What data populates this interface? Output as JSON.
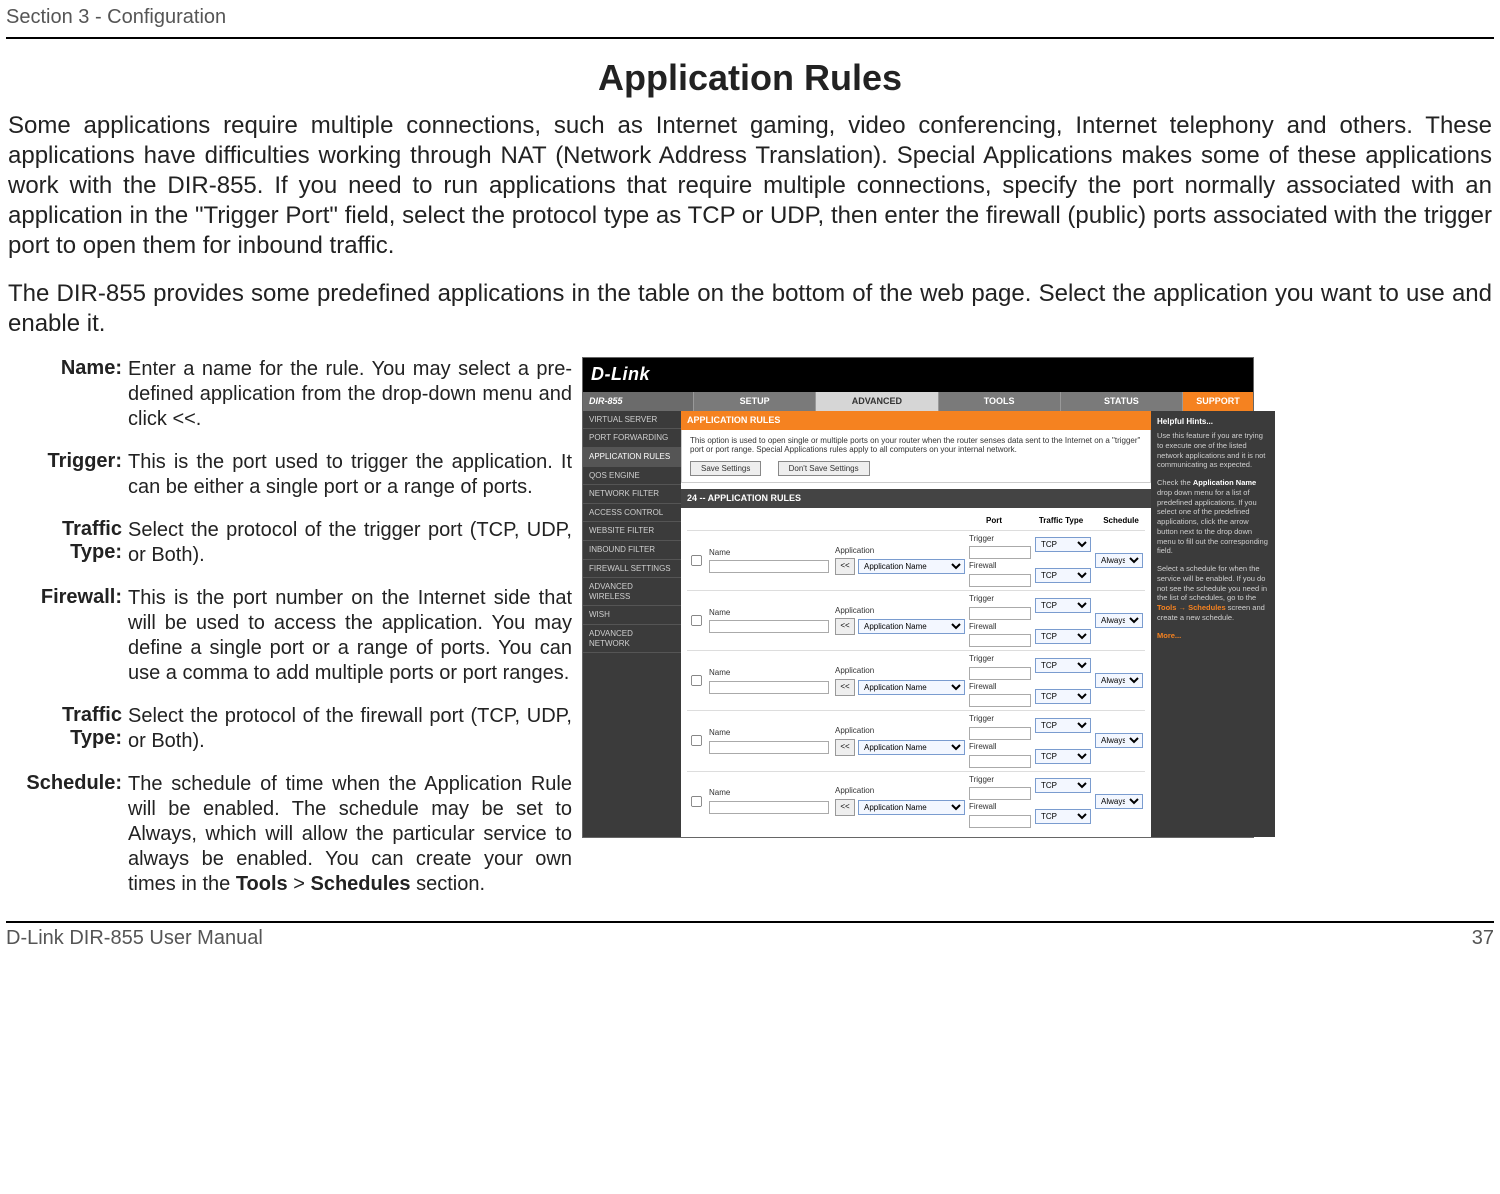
{
  "doc": {
    "section_header": "Section 3 - Configuration",
    "title": "Application Rules",
    "intro1": "Some applications require multiple connections, such as Internet gaming, video conferencing, Internet telephony and others. These applications have difficulties working through NAT (Network Address Translation). Special Applications makes some of these applications work with the DIR-855. If you need to run applications that require multiple connections, specify the port normally associated with an application in the \"Trigger Port\" field, select the protocol type as TCP or UDP, then enter the firewall (public) ports associated with the trigger port to open them for inbound traffic.",
    "intro2": "The DIR-855 provides some predefined applications in the table on the bottom of the web page. Select the application you want to use and enable it.",
    "footer_left": "D-Link DIR-855 User Manual",
    "footer_right": "37"
  },
  "defs": [
    {
      "term": "Name:",
      "desc": "Enter a name for the rule. You may select a pre-defined application from the drop-down menu and click <<."
    },
    {
      "term": "Trigger:",
      "desc": "This is the port used to trigger the application. It can be either a single port or a range of ports."
    },
    {
      "term": "Traffic Type:",
      "desc": "Select the protocol of the trigger port (TCP, UDP, or Both)."
    },
    {
      "term": "Firewall:",
      "desc": "This is the port number on the Internet side that will be used to access the application. You may define a single port or a range of ports. You can use a comma to add multiple ports or port ranges."
    },
    {
      "term": "Traffic Type:",
      "desc": "Select the protocol of the firewall port (TCP, UDP, or Both)."
    },
    {
      "term": "Schedule:",
      "desc_parts": [
        "The schedule of time when the Application Rule will be enabled. The schedule may be set to Always, which will allow the particular service to always be enabled. You can create your own times in the ",
        "Tools",
        " > ",
        "Schedules",
        " section."
      ]
    }
  ],
  "ui": {
    "logo": "D-Link",
    "model": "DIR-855",
    "tabs": [
      "SETUP",
      "ADVANCED",
      "TOOLS",
      "STATUS",
      "SUPPORT"
    ],
    "leftnav": [
      "VIRTUAL SERVER",
      "PORT FORWARDING",
      "APPLICATION RULES",
      "QOS ENGINE",
      "NETWORK FILTER",
      "ACCESS CONTROL",
      "WEBSITE FILTER",
      "INBOUND FILTER",
      "FIREWALL SETTINGS",
      "ADVANCED WIRELESS",
      "WISH",
      "ADVANCED NETWORK"
    ],
    "panel_title": "APPLICATION RULES",
    "panel_text": "This option is used to open single or multiple ports on your router when the router senses data sent to the Internet on a \"trigger\" port or port range. Special Applications rules apply to all computers on your internal network.",
    "save_btn": "Save Settings",
    "dont_save_btn": "Don't Save Settings",
    "rules_header": "24 -- APPLICATION RULES",
    "cols": {
      "port": "Port",
      "traffic": "Traffic Type",
      "schedule": "Schedule"
    },
    "row_labels": {
      "name": "Name",
      "app": "Application",
      "trigger": "Trigger",
      "firewall": "Firewall"
    },
    "arrow": "<<",
    "app_select": "Application Name",
    "tcp": "TCP",
    "schedule": "Always",
    "rows": 5,
    "hints": {
      "title": "Helpful Hints...",
      "p1": "Use this feature if you are trying to execute one of the listed network applications and it is not communicating as expected.",
      "p2a": "Check the ",
      "p2b": "Application Name",
      "p2c": " drop down menu for a list of predefined applications. If you select one of the predefined applications, click the arrow button next to the drop down menu to fill out the corresponding field.",
      "p3a": "Select a schedule for when the service will be enabled. If you do not see the schedule you need in the list of schedules, go to the ",
      "p3b": "Tools → Schedules",
      "p3c": " screen and create a new schedule.",
      "more": "More..."
    }
  }
}
